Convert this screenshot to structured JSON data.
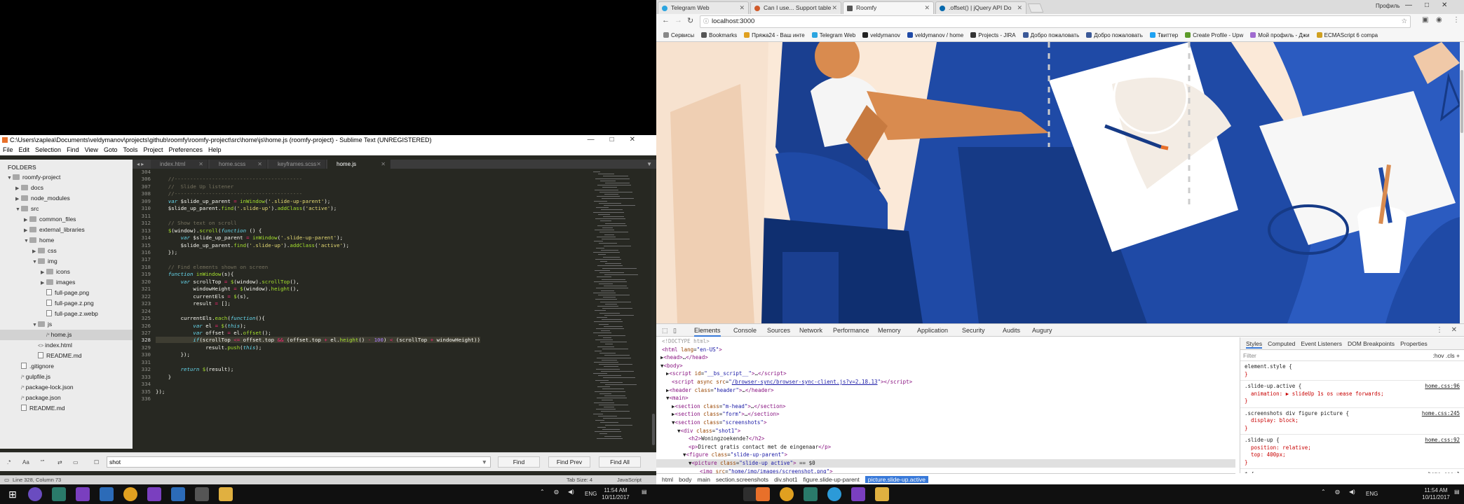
{
  "sublime": {
    "title": "C:\\Users\\zaplea\\Documents\\veldymanov\\projects\\github\\roomfy\\roomfy-project\\src\\home\\js\\home.js (roomfy-project) - Sublime Text (UNREGISTERED)",
    "menu": [
      "File",
      "Edit",
      "Selection",
      "Find",
      "View",
      "Goto",
      "Tools",
      "Project",
      "Preferences",
      "Help"
    ],
    "folders_label": "FOLDERS",
    "tree": [
      {
        "label": "roomfy-project",
        "depth": 0,
        "arrow": "▼",
        "type": "folder"
      },
      {
        "label": "docs",
        "depth": 1,
        "arrow": "▶",
        "type": "folder"
      },
      {
        "label": "node_modules",
        "depth": 1,
        "arrow": "▶",
        "type": "folder"
      },
      {
        "label": "src",
        "depth": 1,
        "arrow": "▼",
        "type": "folder"
      },
      {
        "label": "common_files",
        "depth": 2,
        "arrow": "▶",
        "type": "folder"
      },
      {
        "label": "external_libraries",
        "depth": 2,
        "arrow": "▶",
        "type": "folder"
      },
      {
        "label": "home",
        "depth": 2,
        "arrow": "▼",
        "type": "folder"
      },
      {
        "label": "css",
        "depth": 3,
        "arrow": "▶",
        "type": "folder"
      },
      {
        "label": "img",
        "depth": 3,
        "arrow": "▼",
        "type": "folder"
      },
      {
        "label": "icons",
        "depth": 4,
        "arrow": "▶",
        "type": "folder"
      },
      {
        "label": "images",
        "depth": 4,
        "arrow": "▶",
        "type": "folder"
      },
      {
        "label": "full-page.png",
        "depth": 4,
        "arrow": "",
        "type": "file"
      },
      {
        "label": "full-page.z.png",
        "depth": 4,
        "arrow": "",
        "type": "file"
      },
      {
        "label": "full-page.z.webp",
        "depth": 4,
        "arrow": "",
        "type": "file"
      },
      {
        "label": "js",
        "depth": 3,
        "arrow": "▼",
        "type": "folder"
      },
      {
        "label": "home.js",
        "depth": 4,
        "arrow": "",
        "type": "file",
        "prefix": "/* ",
        "selected": true
      },
      {
        "label": "index.html",
        "depth": 3,
        "arrow": "",
        "type": "file",
        "prefix": "<> "
      },
      {
        "label": "README.md",
        "depth": 3,
        "arrow": "",
        "type": "file"
      },
      {
        "label": ".gitignore",
        "depth": 1,
        "arrow": "",
        "type": "file"
      },
      {
        "label": "gulpfile.js",
        "depth": 1,
        "arrow": "",
        "type": "file",
        "prefix": "/* "
      },
      {
        "label": "package-lock.json",
        "depth": 1,
        "arrow": "",
        "type": "file",
        "prefix": "/* "
      },
      {
        "label": "package.json",
        "depth": 1,
        "arrow": "",
        "type": "file",
        "prefix": "/* "
      },
      {
        "label": "README.md",
        "depth": 1,
        "arrow": "",
        "type": "file"
      }
    ],
    "tabs": [
      "index.html",
      "home.scss",
      "keyframes.scss",
      "home.js"
    ],
    "line_numbers": [
      "304",
      "",
      "306",
      "307",
      "308",
      "309",
      "310",
      "311",
      "312",
      "313",
      "314",
      "315",
      "316",
      "317",
      "318",
      "319",
      "320",
      "321",
      "322",
      "323",
      "324",
      "325",
      "326",
      "327",
      "328",
      "329",
      "330",
      "331",
      "332",
      "333",
      "334",
      "335",
      "336"
    ],
    "find_value": "shot",
    "find_buttons": [
      "Find",
      "Find Prev",
      "Find All"
    ],
    "status_left": "Line 328, Column 73",
    "status_tab": "Tab Size: 4",
    "status_syntax": "JavaScript"
  },
  "chrome": {
    "tabs": [
      {
        "label": "Telegram Web",
        "color": "#2ca5e0"
      },
      {
        "label": "Can I use... Support table",
        "color": "#d05a2a"
      },
      {
        "label": "Roomfy",
        "color": "#555555"
      },
      {
        "label": ".offset() | jQuery API Do",
        "color": "#0769ad"
      }
    ],
    "profile": "Профиль",
    "url": "localhost:3000",
    "bookmarks": [
      "Сервисы",
      "Bookmarks",
      "Пряжа24 - Ваш инте",
      "Telegram Web",
      "veldymanov",
      "veldymanov / home",
      "Projects - JIRA",
      "Добро пожаловать",
      "Добро пожаловать",
      "Твиттер",
      "Create Profile - Upw",
      "Мой профиль - Джи",
      "ECMAScript 6 compa"
    ],
    "devtools_tabs": [
      "Elements",
      "Console",
      "Sources",
      "Network",
      "Performance",
      "Memory",
      "Application",
      "Security",
      "Audits",
      "Augury"
    ],
    "styles_tabs": [
      "Styles",
      "Computed",
      "Event Listeners",
      "DOM Breakpoints",
      "Properties"
    ],
    "filter_placeholder": "Filter",
    "filter_right": ":hov  .cls  +",
    "breadcrumbs": [
      "html",
      "body",
      "main",
      "section.screenshots",
      "div.shot1",
      "figure.slide-up-parent",
      "picture.slide-up.active"
    ],
    "rules": [
      {
        "selector": "element.style {",
        "body": "}",
        "src": ""
      },
      {
        "selector": ".slide-up.active {",
        "body": "  animation: ▶ slideUp 1s os ☑ease forwards;\n}",
        "src": "home.css:96"
      },
      {
        "selector": ".screenshots div figure picture {",
        "body": "  display: block;\n}",
        "src": "home.css:245"
      },
      {
        "selector": ".slide-up {",
        "body": "  position: relative;\n  top: 400px;\n}",
        "src": "home.css:92"
      },
      {
        "selector": "* {",
        "body": "",
        "src": "home.css:1"
      }
    ]
  },
  "taskbar": {
    "time": "11:54 AM",
    "date": "10/11/2017",
    "lang": "ENG"
  }
}
